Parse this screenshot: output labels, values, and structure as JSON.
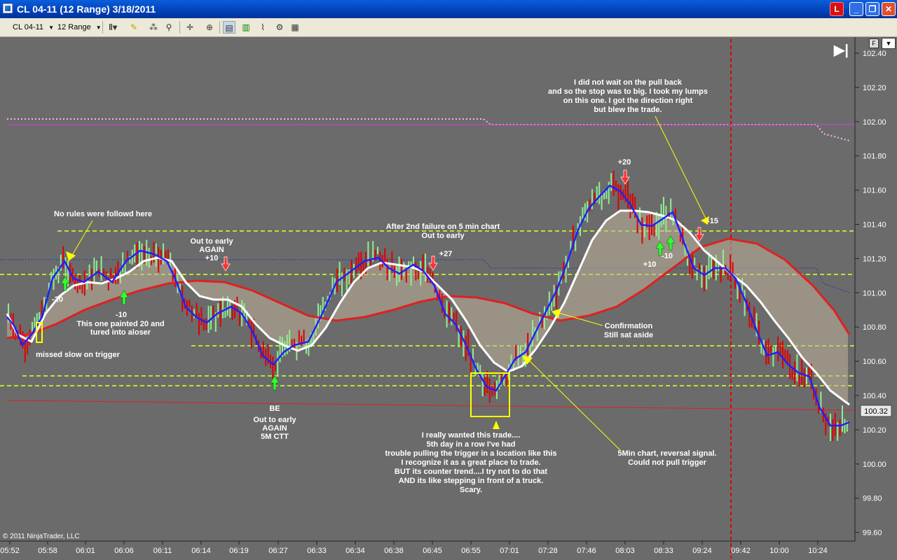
{
  "window": {
    "title": "CL 04-11 (12 Range)  3/18/2011",
    "alert_label": "L",
    "minimize_label": "_",
    "maximize_label": "❐",
    "close_label": "✕"
  },
  "toolbar": {
    "instrument": "CL 04-11",
    "interval": "12 Range",
    "icons": [
      "bar-style-icon",
      "drawing-pencil-icon",
      "strategy-icon",
      "magic-wand-icon",
      "crosshair-icon",
      "zoom-icon",
      "data-box-icon",
      "chart-trader-icon",
      "indicators-icon",
      "strategies-icon",
      "properties-icon"
    ]
  },
  "price_axis": {
    "labels": [
      "102.40",
      "102.20",
      "102.00",
      "101.80",
      "101.60",
      "101.40",
      "101.20",
      "101.00",
      "100.80",
      "100.60",
      "100.40",
      "100.20",
      "100.00",
      "99.80",
      "99.60"
    ],
    "current_price": "100.32"
  },
  "time_axis": {
    "labels": [
      "05:52",
      "05:58",
      "06:01",
      "06:06",
      "06:11",
      "06:14",
      "06:19",
      "06:27",
      "06:33",
      "06:34",
      "06:38",
      "06:45",
      "06:55",
      "07:01",
      "07:28",
      "07:46",
      "08:03",
      "08:33",
      "09:24",
      "09:42",
      "10:00",
      "10:24"
    ]
  },
  "copyright": "© 2011 NinjaTrader, LLC",
  "buttons": {
    "f_label": "F",
    "dropdown_label": "▼",
    "scroll_end_label": "▶|"
  },
  "annotations": {
    "no_rules": "No rules were followd here",
    "minus20": "-20",
    "minus10_a": "-10",
    "painted_20_1": "This one painted 20 and",
    "painted_20_2": "tured into aloser",
    "missed_slow": "missed slow on trigger",
    "out_early_1": "Out to early",
    "out_early_2": "AGAIN",
    "plus10_a": "+10",
    "be": "BE",
    "out_early_3": "Out to early",
    "out_early_4": "AGAIN",
    "cct": "5M CTT",
    "second_failure_1": "After 2nd failure on 5 min chart",
    "second_failure_2": "Out to early",
    "plus27": "+27",
    "wanted_1": "I really wanted this trade....",
    "wanted_2": "5th day in a row I've had",
    "wanted_3": "trouble pulling the trigger in a location like this",
    "wanted_4": "I recognize it as a great place to trade.",
    "wanted_5": "BUT its counter trend....I try not to do that",
    "wanted_6": "AND its like stepping in front of a truck.",
    "wanted_7": "Scary.",
    "confirm_1": "Confirmation",
    "confirm_2": "Still sat aside",
    "reversal_1": "5Min chart, reversal signal.",
    "reversal_2": "Could not pull trigger",
    "plus20": "+20",
    "plus10_b": "+10",
    "minus10_b": "-10",
    "minus15": "-15",
    "pullback_1": "I did not wait on the pull back",
    "pullback_2": "and so the stop was to big. I took my lumps",
    "pullback_3": "on this one. I got the direction right",
    "pullback_4": "but blew the trade."
  },
  "colors": {
    "background": "#6b6b6b",
    "up_bar": "#90ee90",
    "down_bar": "#e00000",
    "fast_ma": "#2020ff",
    "slow_ma": "#ffffff",
    "long_ma": "#e02020",
    "level_line": "#b8e62e",
    "callout": "#ffff00"
  }
}
